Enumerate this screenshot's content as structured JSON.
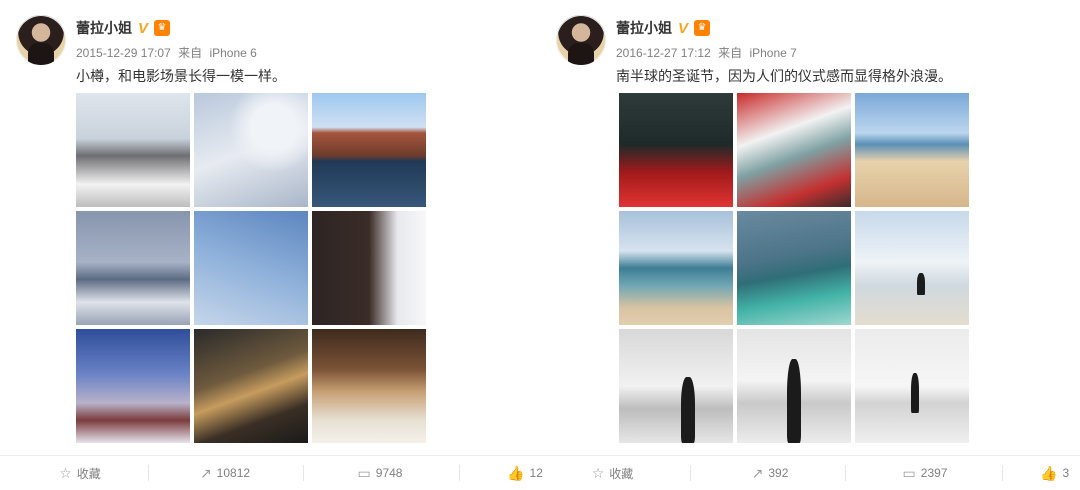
{
  "posts": [
    {
      "username": "蕾拉小姐",
      "verified_mark": "V",
      "timestamp": "2015-12-29 17:07",
      "source_prefix": "来自",
      "source": "iPhone 6",
      "text": "小樽，和电影场景长得一模一样。",
      "photos": [
        "street",
        "tree",
        "canal",
        "town",
        "sky",
        "house",
        "dusk",
        "model",
        "snowman"
      ]
    },
    {
      "username": "蕾拉小姐",
      "verified_mark": "V",
      "timestamp": "2016-12-27 17:12",
      "source_prefix": "来自",
      "source": "iPhone 7",
      "text": "南半球的圣诞节，因为人们的仪式感而显得格外浪漫。",
      "photos": [
        "bus1",
        "bus2",
        "beach1",
        "beach2",
        "pool",
        "birds",
        "bw1",
        "bw2",
        "bw3"
      ]
    }
  ],
  "actions": {
    "left": {
      "favorite": "收藏",
      "repost": "10812",
      "comment": "9748",
      "like": "12"
    },
    "right": {
      "favorite": "收藏",
      "repost": "392",
      "comment": "2397",
      "like": "3"
    }
  },
  "icons": {
    "favorite": "star-icon",
    "repost": "share-icon",
    "comment": "comment-icon",
    "like": "thumbs-up-icon",
    "vip": "vip-crown-icon"
  },
  "colors": {
    "verified": "#f5a623",
    "vip": "#ff8200",
    "meta_text": "#808080"
  }
}
